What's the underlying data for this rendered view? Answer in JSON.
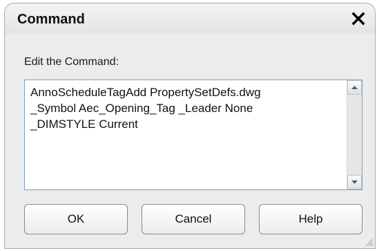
{
  "dialog": {
    "title": "Command",
    "close_icon": "close-icon"
  },
  "content": {
    "prompt": "Edit the Command:",
    "command_text": "AnnoScheduleTagAdd PropertySetDefs.dwg\n_Symbol Aec_Opening_Tag _Leader None\n_DIMSTYLE Current"
  },
  "scrollbar": {
    "up_icon": "scroll-up-arrow-icon",
    "down_icon": "scroll-down-arrow-icon"
  },
  "buttons": {
    "ok": "OK",
    "cancel": "Cancel",
    "help": "Help"
  },
  "resize_icon": "resize-grip-icon"
}
